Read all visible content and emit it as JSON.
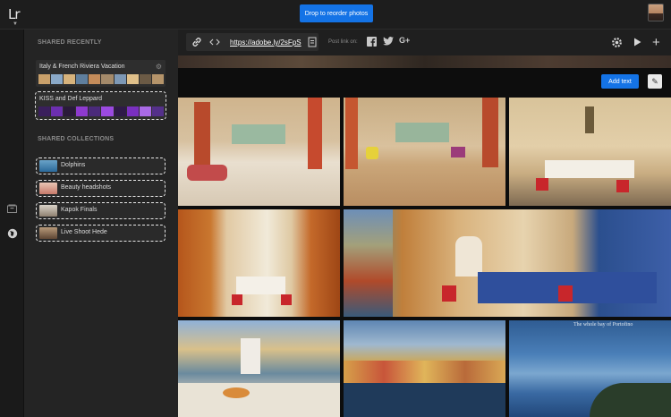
{
  "app": {
    "logo": "Lr"
  },
  "topbar": {
    "toast": "Drop to reorder photos"
  },
  "sidebar": {
    "shared_recently_title": "SHARED RECENTLY",
    "shared_recently": [
      {
        "title": "Italy & French Riviera Vacation"
      },
      {
        "title": "KISS and Def Leppard"
      }
    ],
    "shared_collections_title": "SHARED COLLECTIONS",
    "collections": [
      {
        "label": "Dolphins"
      },
      {
        "label": "Beauty headshots"
      },
      {
        "label": "Kapok Finals"
      },
      {
        "label": "Live Shoot Hede"
      }
    ]
  },
  "toolbar": {
    "url": "https://adobe.ly/2sFpS",
    "post_link_label": "Post link on:",
    "social": [
      "facebook-icon",
      "twitter-icon",
      "google-plus-icon"
    ]
  },
  "gallery": {
    "add_text_label": "Add text",
    "caption_partial": "The whole bay of Portofino"
  },
  "colors": {
    "accent": "#1473e6",
    "sidebar_bg": "#242424",
    "gallery_bg": "#0d0d0d"
  }
}
